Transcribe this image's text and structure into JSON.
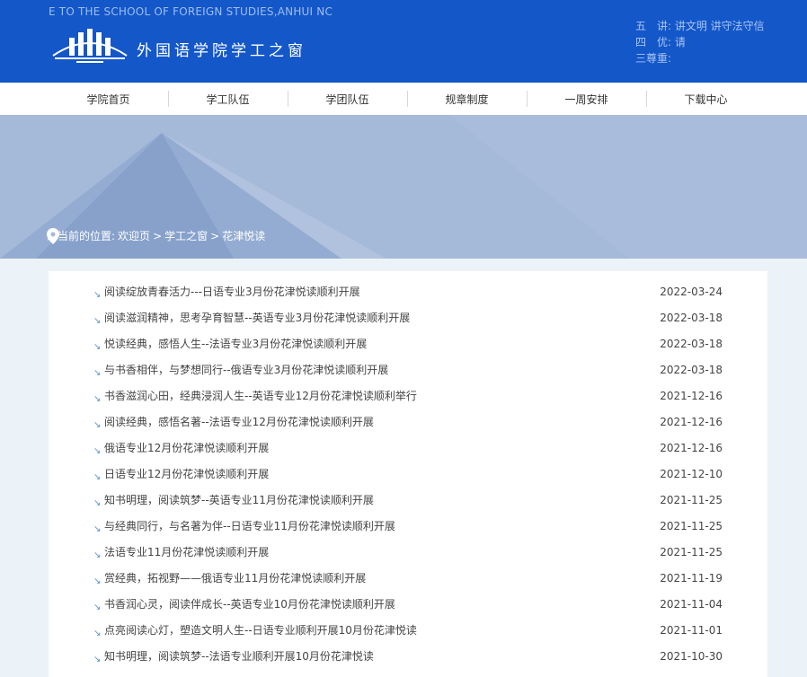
{
  "header": {
    "marquee": "E TO THE SCHOOL OF FOREIGN STUDIES,ANHUI NC",
    "site_title": "外国语学院学工之窗",
    "motto": [
      "五　讲: 讲文明 讲守法守信",
      "四　优: 请",
      "三尊重:"
    ],
    "colors": {
      "header_bg": "#1357c9",
      "banner_bg": "#a5b9d9"
    }
  },
  "nav": {
    "items": [
      {
        "label": "学院首页"
      },
      {
        "label": "学工队伍"
      },
      {
        "label": "学团队伍"
      },
      {
        "label": "规章制度"
      },
      {
        "label": "一周安排"
      },
      {
        "label": "下载中心"
      }
    ]
  },
  "breadcrumb": {
    "prefix": "您当前的位置:",
    "items": [
      "欢迎页",
      ">",
      "学工之窗",
      ">",
      "花津悦读"
    ]
  },
  "articles": [
    {
      "title": "阅读绽放青春活力---日语专业3月份花津悦读顺利开展",
      "date": "2022-03-24"
    },
    {
      "title": "阅读滋润精神，思考孕育智慧--英语专业3月份花津悦读顺利开展",
      "date": "2022-03-18"
    },
    {
      "title": "悦读经典，感悟人生--法语专业3月份花津悦读顺利开展",
      "date": "2022-03-18"
    },
    {
      "title": "与书香相伴，与梦想同行--俄语专业3月份花津悦读顺利开展",
      "date": "2022-03-18"
    },
    {
      "title": "书香滋润心田，经典浸润人生--英语专业12月份花津悦读顺利举行",
      "date": "2021-12-16"
    },
    {
      "title": "阅读经典，感悟名著--法语专业12月份花津悦读顺利开展",
      "date": "2021-12-16"
    },
    {
      "title": "俄语专业12月份花津悦读顺利开展",
      "date": "2021-12-16"
    },
    {
      "title": "日语专业12月份花津悦读顺利开展",
      "date": "2021-12-10"
    },
    {
      "title": "知书明理，阅读筑梦--英语专业11月份花津悦读顺利开展",
      "date": "2021-11-25"
    },
    {
      "title": "与经典同行，与名著为伴--日语专业11月份花津悦读顺利开展",
      "date": "2021-11-25"
    },
    {
      "title": "法语专业11月份花津悦读顺利开展",
      "date": "2021-11-25"
    },
    {
      "title": "赏经典，拓视野——俄语专业11月份花津悦读顺利开展",
      "date": "2021-11-19"
    },
    {
      "title": "书香润心灵，阅读伴成长--英语专业10月份花津悦读顺利开展",
      "date": "2021-11-04"
    },
    {
      "title": "点亮阅读心灯，塑造文明人生--日语专业顺利开展10月份花津悦读",
      "date": "2021-11-01"
    },
    {
      "title": "知书明理，阅读筑梦--法语专业顺利开展10月份花津悦读",
      "date": "2021-10-30"
    }
  ]
}
